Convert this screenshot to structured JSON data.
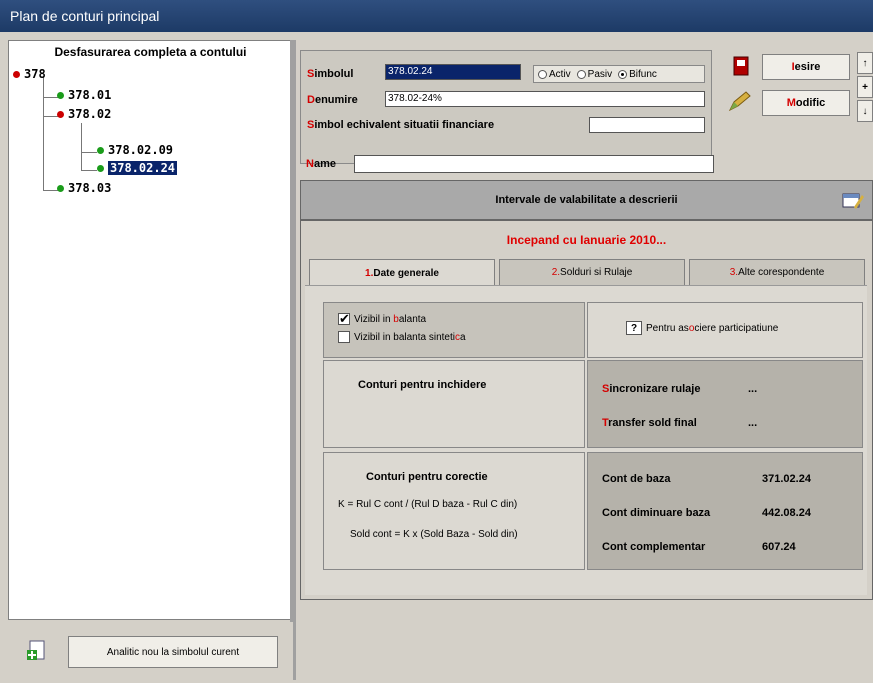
{
  "window": {
    "title": "Plan de conturi principal"
  },
  "tree": {
    "header": "Desfasurarea completa a contului",
    "nodes": [
      {
        "label": "378",
        "status": "red"
      },
      {
        "label": "378.01",
        "status": "green"
      },
      {
        "label": "378.02",
        "status": "red"
      },
      {
        "label": "378.02.09",
        "status": "green"
      },
      {
        "label": "378.02.24",
        "status": "green",
        "selected": true
      },
      {
        "label": "378.03",
        "status": "green"
      }
    ]
  },
  "bottom": {
    "analitic_label": "Analitic nou la simbolul curent"
  },
  "form": {
    "simbol_label_first": "S",
    "simbol_label_rest": "imbolul",
    "simbol_value": "378.02.24",
    "radio": {
      "activ": "Activ",
      "pasiv": "Pasiv",
      "bifunc": "Bifunc",
      "selected": "bifunc"
    },
    "denumire_label_first": "D",
    "denumire_label_rest": "enumire",
    "denumire_value": "378.02-24%",
    "echiv_label_first": "S",
    "echiv_label_rest": "imbol echivalent situatii financiare",
    "echiv_value": "",
    "name_label_first": "N",
    "name_label_rest": "ame",
    "name_value": ""
  },
  "buttons": {
    "iesire_first": "I",
    "iesire_rest": "esire",
    "modific_first": "M",
    "modific_rest": "odific",
    "up": "↑",
    "plus": "+",
    "down": "↓"
  },
  "intervals": {
    "header": "Intervale de valabilitate a descrierii",
    "incepand": "Incepand cu Ianuarie 2010..."
  },
  "tabs": [
    {
      "num": "1.",
      "label": "Date generale",
      "active": true
    },
    {
      "num": "2.",
      "label": "Solduri si Rulaje",
      "active": false
    },
    {
      "num": "3.",
      "label": "Alte corespondente",
      "active": false
    }
  ],
  "general": {
    "vizibil_balanta_pre": "Vizibil in ",
    "vizibil_balanta_hl": "b",
    "vizibil_balanta_post": "alanta",
    "vizibil_balanta_checked": true,
    "vizibil_sintetica_pre": "Vizibil in balanta sinteti",
    "vizibil_sintetica_hl": "c",
    "vizibil_sintetica_post": "a",
    "vizibil_sintetica_checked": false,
    "asociere_q": "?",
    "asociere_pre": "Pentru as",
    "asociere_hl": "o",
    "asociere_post": "ciere participatiune",
    "conturi_inchidere": "Conturi pentru inchidere",
    "sincronizare_first": "S",
    "sincronizare_rest": "incronizare rulaje",
    "sincronizare_value": "...",
    "transfer_first": "T",
    "transfer_rest": "ransfer sold final",
    "transfer_value": "...",
    "conturi_corectie": "Conturi pentru corectie",
    "formula1": "K = Rul C cont / (Rul D baza - Rul C din)",
    "formula2": "Sold cont = K x (Sold Baza - Sold din)",
    "cont_baza_label": "Cont de baza",
    "cont_baza_value": "371.02.24",
    "cont_diminuare_label": "Cont diminuare baza",
    "cont_diminuare_value": "442.08.24",
    "cont_complementar_label": "Cont complementar",
    "cont_complementar_value": "607.24"
  }
}
